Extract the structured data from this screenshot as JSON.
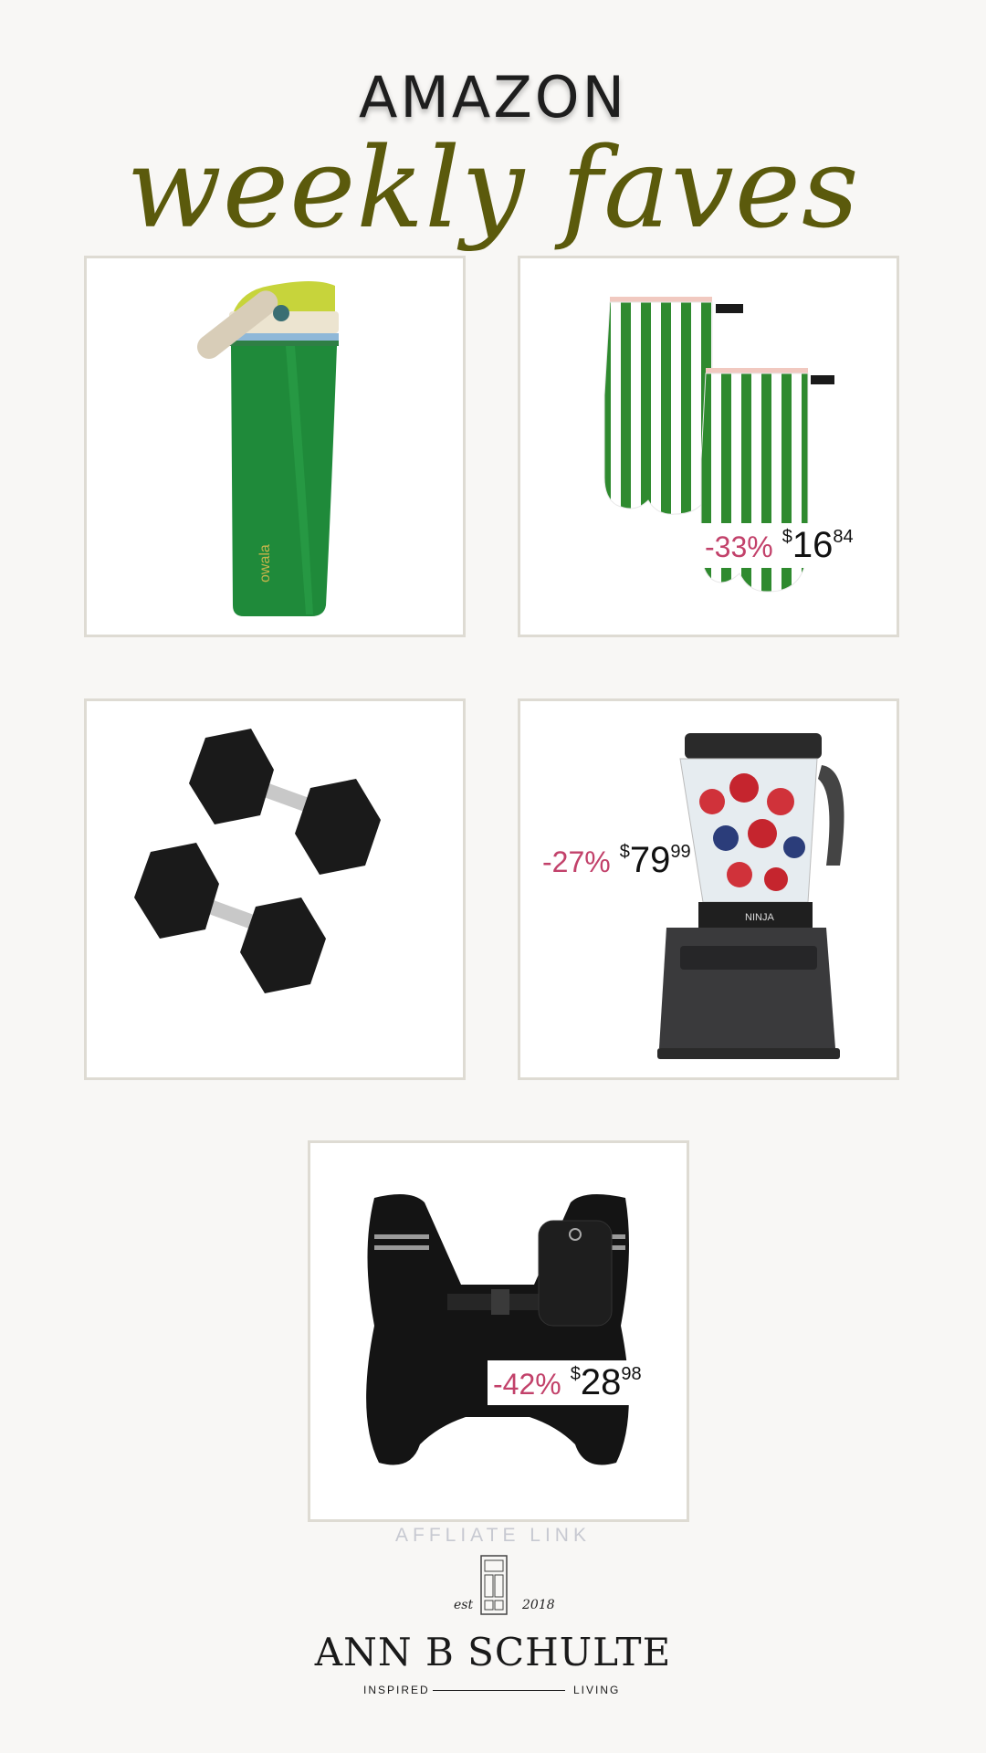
{
  "header": {
    "title": "AMAZON",
    "subtitle": "weekly faves"
  },
  "products": [
    {
      "name": "owala",
      "icon": "water-bottle-icon"
    },
    {
      "icon": "oven-mitts-icon",
      "discount": "-33%",
      "currency": "$",
      "price": "16",
      "cents": "84"
    },
    {
      "icon": "dumbbells-icon"
    },
    {
      "icon": "blender-icon",
      "discount": "-27%",
      "currency": "$",
      "price": "79",
      "cents": "99",
      "brand": "NINJA"
    },
    {
      "icon": "weighted-vest-icon",
      "discount": "-42%",
      "currency": "$",
      "price": "28",
      "cents": "98"
    }
  ],
  "footer": {
    "affiliate": "AFFLIATE LINK",
    "est": "est",
    "year": "2018",
    "brand": "ANN B SCHULTE",
    "tagline_left": "INSPIRED",
    "tagline_right": "LIVING"
  },
  "colors": {
    "background": "#f8f7f5",
    "script_accent": "#5b5a0c",
    "discount": "#c2416a",
    "card_border": "#dedbd3"
  }
}
